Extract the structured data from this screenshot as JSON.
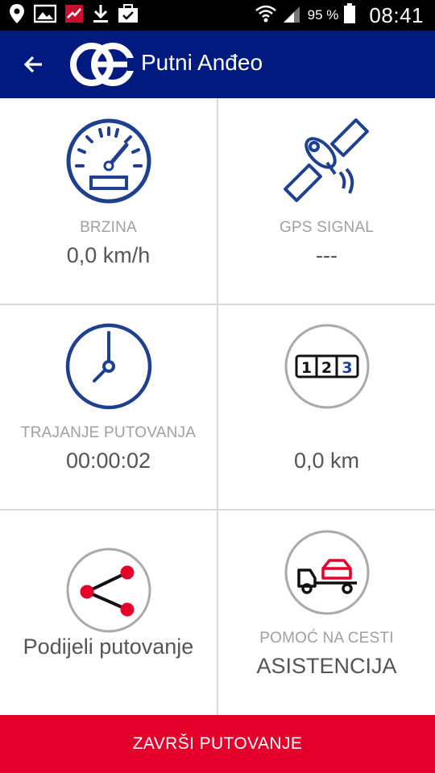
{
  "status_bar": {
    "battery_percent": "95 %",
    "time": "08:41",
    "icons": [
      "location-icon",
      "image-icon",
      "app-notification-icon",
      "download-icon",
      "briefcase-check-icon",
      "wifi-icon",
      "signal-icon",
      "battery-icon"
    ]
  },
  "app_bar": {
    "title": "Putni Anđeo",
    "back_icon": "arrow-left-icon",
    "logo": "company-logo"
  },
  "tiles": {
    "speed": {
      "label": "BRZINA",
      "value": "0,0 km/h",
      "icon": "speedometer-icon"
    },
    "gps": {
      "label": "GPS SIGNAL",
      "value": "---",
      "icon": "satellite-icon"
    },
    "duration": {
      "label": "TRAJANJE PUTOVANJA",
      "value": "00:00:02",
      "icon": "clock-icon"
    },
    "distance": {
      "value": "0,0 km",
      "icon": "odometer-icon"
    },
    "share": {
      "value": "Podijeli putovanje",
      "icon": "share-icon"
    },
    "assistance": {
      "label": "POMOĆ NA CESTI",
      "value": "ASISTENCIJA",
      "icon": "tow-truck-icon"
    }
  },
  "footer": {
    "end_button": "ZAVRŠI PUTOVANJE"
  },
  "colors": {
    "app_bar": "#001a80",
    "icon_blue": "#1f3f8f",
    "accent_red": "#e4002b",
    "label_gray": "#a0a0a0",
    "value_gray": "#555555"
  }
}
